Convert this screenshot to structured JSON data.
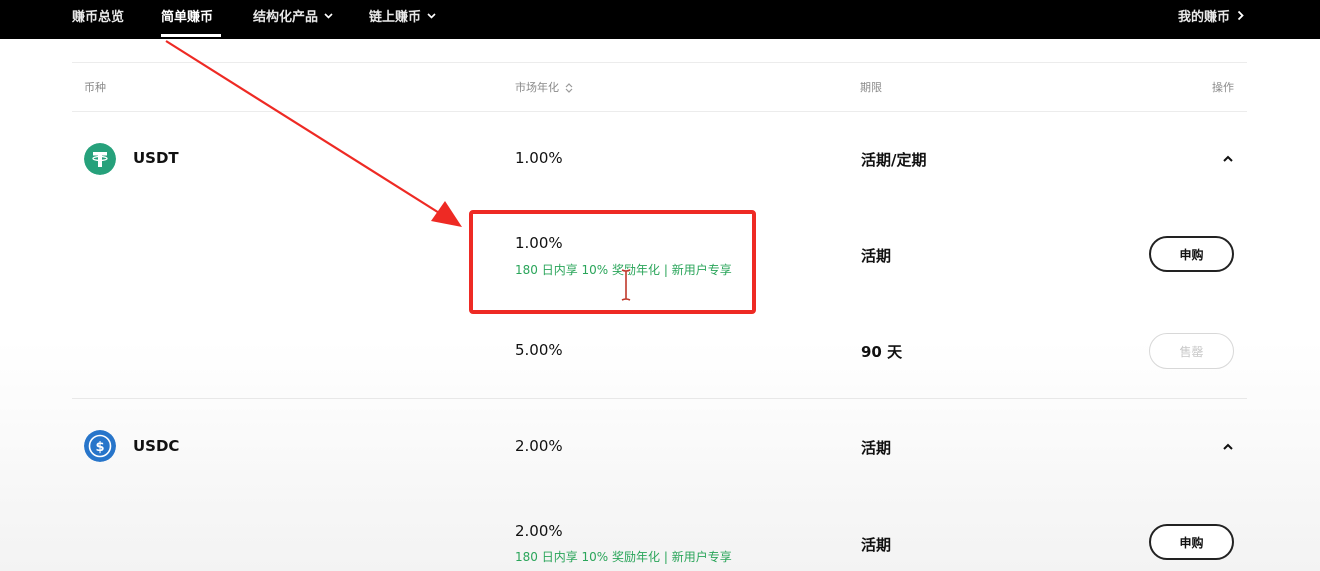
{
  "nav": {
    "items": [
      {
        "label": "赚币总览"
      },
      {
        "label": "简单赚币"
      },
      {
        "label": "结构化产品"
      },
      {
        "label": "链上赚币"
      }
    ],
    "my_earn_label": "我的赚币"
  },
  "table": {
    "headers": {
      "coin": "币种",
      "apr": "市场年化",
      "term": "期限",
      "action": "操作"
    },
    "groups": [
      {
        "coin": "USDT",
        "icon": "tether-icon",
        "color": "#26a17b",
        "summary_rate": "1.00%",
        "summary_term": "活期/定期",
        "products": [
          {
            "rate": "1.00%",
            "promo": "180 日内享 10% 奖励年化 | 新用户专享",
            "term": "活期",
            "action": "申购"
          },
          {
            "rate": "5.00%",
            "term": "90 天",
            "action": "售罄"
          }
        ]
      },
      {
        "coin": "USDC",
        "icon": "usdc-icon",
        "color": "#2775ca",
        "summary_rate": "2.00%",
        "summary_term": "活期",
        "products": [
          {
            "rate": "2.00%",
            "promo": "180 日内享 10% 奖励年化 | 新用户专享",
            "term": "活期",
            "action": "申购"
          }
        ]
      }
    ]
  },
  "annotation": {
    "arrow_color": "#ee2a24",
    "box_color": "#ee2a24"
  }
}
